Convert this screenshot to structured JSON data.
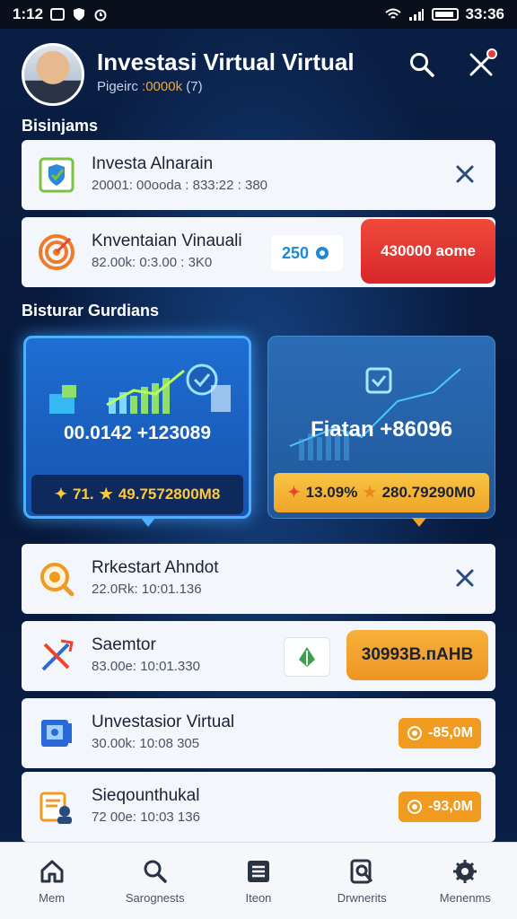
{
  "status_bar": {
    "time": "1:12",
    "clock_right": "33:36"
  },
  "header": {
    "title": "Investasi Virtual Virtual",
    "subtitle_prefix": "Pigeirc ",
    "subtitle_accent": ":0000k",
    "subtitle_suffix": " (7)"
  },
  "section1": {
    "title": "Bisinjams"
  },
  "cards_top": [
    {
      "title": "Investa Alnarain",
      "sub": "20001: 00ooda : 833:22 : 380"
    },
    {
      "title": "Knventaian Vinauali",
      "sub": "82.00k: 0:3.00 : 3K0",
      "badge": "250",
      "pill": "430000 aome"
    }
  ],
  "section2": {
    "title": "Bisturar Gurdians"
  },
  "panels": [
    {
      "big": "00.0142 +123089",
      "strip_a": "71.",
      "strip_b": "49.7572800M8"
    },
    {
      "big": "Fiatan +86096",
      "strip_a": "13.09%",
      "strip_b": "280.79290M0"
    }
  ],
  "cards_bottom": [
    {
      "title": "Rrkestart Ahndot",
      "sub": "22.0Rk: 10:01.136"
    },
    {
      "title": "Saemtor",
      "sub": "83.00e: 10:01.330",
      "pill": "30993B.пAHB"
    },
    {
      "title": "Unvestasior Virtual",
      "sub": "30.00k: 10:08 305",
      "amount": "-85,0M"
    },
    {
      "title": "Sieqounthukal",
      "sub": "72 00e: 10:03 136",
      "amount": "-93,0M"
    }
  ],
  "nav": [
    {
      "label": "Mem"
    },
    {
      "label": "Sarognests"
    },
    {
      "label": "Iteon"
    },
    {
      "label": "Drwnerits"
    },
    {
      "label": "Menenms"
    }
  ],
  "colors": {
    "accent_orange": "#f09a1f",
    "accent_red": "#e83b3b",
    "accent_blue": "#1b8ad8",
    "bg_dark": "#071a3a"
  }
}
